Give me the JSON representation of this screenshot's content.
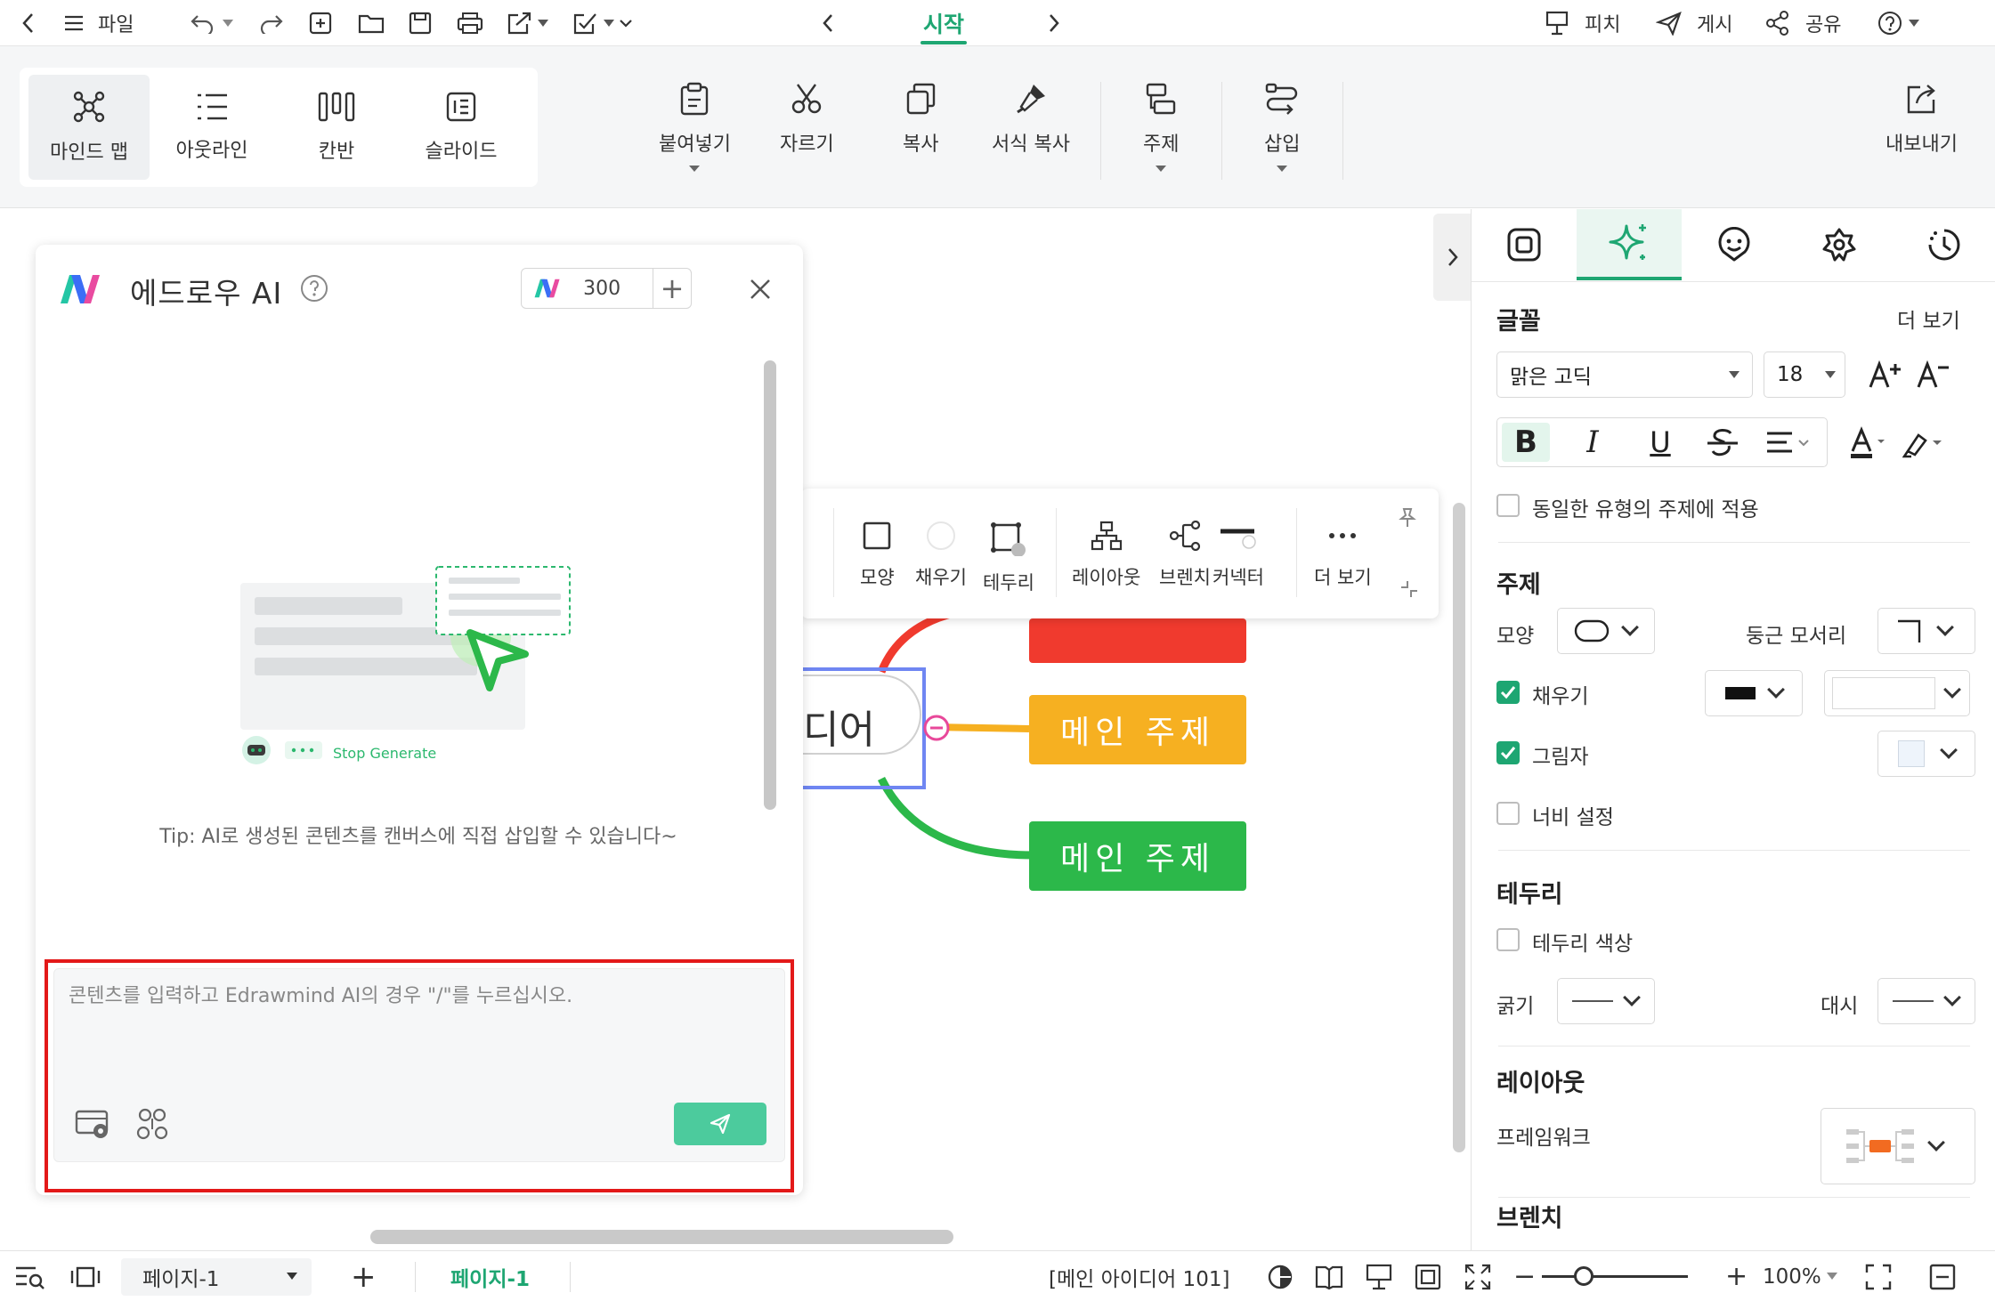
{
  "titlebar": {
    "file_label": "파일",
    "active_tab": "시작",
    "pitch_label": "피치",
    "publish_label": "게시",
    "share_label": "공유"
  },
  "ribbon": {
    "views": [
      "마인드 맵",
      "아웃라인",
      "칸반",
      "슬라이드"
    ],
    "paste_label": "붙여넣기",
    "cut_label": "자르기",
    "copy_label": "복사",
    "format_painter_label": "서식 복사",
    "topic_label": "주제",
    "insert_label": "삽입",
    "export_label": "내보내기"
  },
  "ai_panel": {
    "title": "에드로우 AI",
    "credits": "300",
    "stop_generate": "Stop Generate",
    "tip": "Tip: AI로 생성된 콘텐츠를 캔버스에 직접 삽입할 수 있습니다~",
    "input_placeholder": "콘텐츠를 입력하고 Edrawmind AI의 경우 \"/\"를 누르십시오."
  },
  "float_toolbar": {
    "shape_label": "모양",
    "fill_label": "채우기",
    "border_label": "테두리",
    "layout_label": "레이아웃",
    "branch_label": "브렌치",
    "connector_label": "커넥터",
    "more_label": "더 보기"
  },
  "canvas": {
    "central_partial": "디어",
    "topic_orange": "메인 주제",
    "topic_green": "메인 주제"
  },
  "right_panel": {
    "font_heading": "글꼴",
    "more": "더 보기",
    "font_family": "맑은 고딕",
    "font_size": "18",
    "apply_same": "동일한 유형의 주제에 적용",
    "topic_heading": "주제",
    "shape_label": "모양",
    "rounded_label": "둥근 모서리",
    "fill_label": "채우기",
    "shadow_label": "그림자",
    "width_label": "너비 설정",
    "border_heading": "테두리",
    "border_color_label": "테두리 색상",
    "thickness_label": "굵기",
    "dash_label": "대시",
    "layout_heading": "레이아웃",
    "framework_label": "프레임워크",
    "branch_heading": "브렌치"
  },
  "statusbar": {
    "page_select": "페이지-1",
    "active_page": "페이지-1",
    "topic_count": "[메인 아이디어 101]",
    "zoom": "100%"
  },
  "colors": {
    "accent": "#1ea672",
    "topic_red": "#f03a2e",
    "topic_orange": "#f6b021",
    "topic_green": "#2cb84a",
    "frame_blue": "#6f86f2",
    "highlight_red": "#e31919"
  }
}
